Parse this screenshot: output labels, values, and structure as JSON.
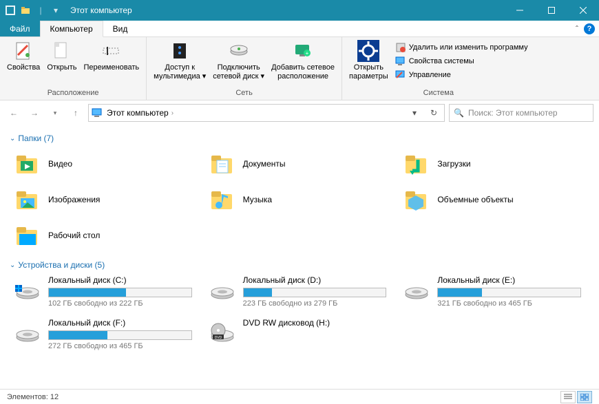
{
  "title": "Этот компьютер",
  "menu": {
    "file": "Файл",
    "computer": "Компьютер",
    "view": "Вид"
  },
  "ribbon": {
    "properties": "Свойства",
    "open": "Открыть",
    "rename": "Переименовать",
    "group_location": "Расположение",
    "media_access": "Доступ к\nмультимедиа ▾",
    "map_drive": "Подключить\nсетевой диск ▾",
    "add_netloc": "Добавить сетевое\nрасположение",
    "group_network": "Сеть",
    "open_settings": "Открыть\nпараметры",
    "uninstall": "Удалить или изменить программу",
    "sys_props": "Свойства системы",
    "manage": "Управление",
    "group_system": "Система"
  },
  "address": {
    "crumb": "Этот компьютер"
  },
  "search": {
    "placeholder": "Поиск: Этот компьютер"
  },
  "folders": {
    "header": "Папки (7)",
    "items": [
      {
        "label": "Видео"
      },
      {
        "label": "Документы"
      },
      {
        "label": "Загрузки"
      },
      {
        "label": "Изображения"
      },
      {
        "label": "Музыка"
      },
      {
        "label": "Объемные объекты"
      },
      {
        "label": "Рабочий стол"
      }
    ]
  },
  "drives": {
    "header": "Устройства и диски (5)",
    "items": [
      {
        "name": "Локальный диск (C:)",
        "status": "102 ГБ свободно из 222 ГБ",
        "fill": 54,
        "type": "hdd",
        "os": true
      },
      {
        "name": "Локальный диск (D:)",
        "status": "223 ГБ свободно из 279 ГБ",
        "fill": 20,
        "type": "hdd"
      },
      {
        "name": "Локальный диск (E:)",
        "status": "321 ГБ свободно из 465 ГБ",
        "fill": 31,
        "type": "hdd"
      },
      {
        "name": "Локальный диск (F:)",
        "status": "272 ГБ свободно из 465 ГБ",
        "fill": 41,
        "type": "hdd"
      },
      {
        "name": "DVD RW дисковод (H:)",
        "status": "",
        "type": "dvd"
      }
    ]
  },
  "status": {
    "elements": "Элементов: 12"
  }
}
